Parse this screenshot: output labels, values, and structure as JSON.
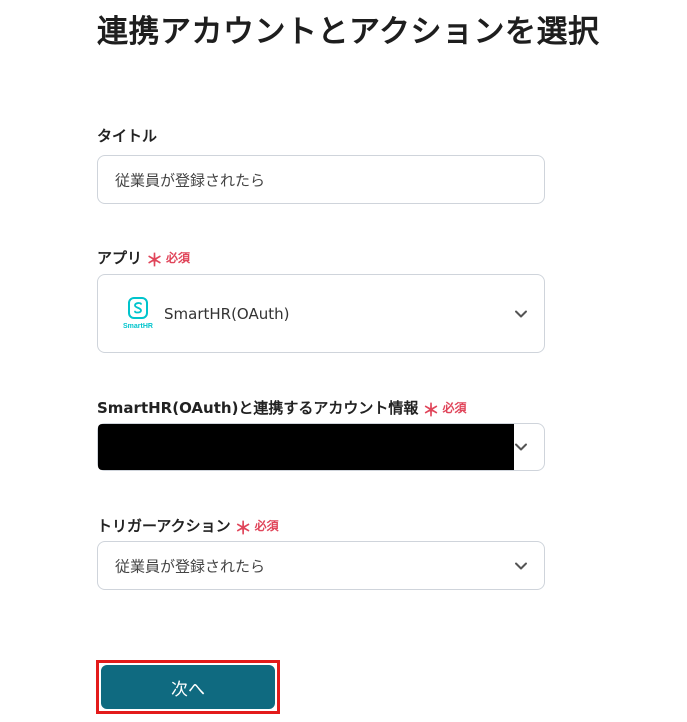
{
  "page": {
    "title": "連携アカウントとアクションを選択"
  },
  "fields": {
    "title": {
      "label": "タイトル",
      "value": "従業員が登録されたら"
    },
    "app": {
      "label": "アプリ",
      "required_mark": "＊",
      "required_text": "必須",
      "value": "SmartHR(OAuth)",
      "logo_text": "SmartHR",
      "icon": "smarthr-logo"
    },
    "account": {
      "label": "SmartHR(OAuth)と連携するアカウント情報",
      "required_mark": "＊",
      "required_text": "必須"
    },
    "trigger": {
      "label": "トリガーアクション",
      "required_mark": "＊",
      "required_text": "必須",
      "value": "従業員が登録されたら"
    }
  },
  "buttons": {
    "next": "次へ"
  },
  "colors": {
    "accent": "#0f6a80",
    "required": "#e0455a",
    "highlight": "#e31b1b",
    "smarthr_brand": "#00c4cc"
  }
}
